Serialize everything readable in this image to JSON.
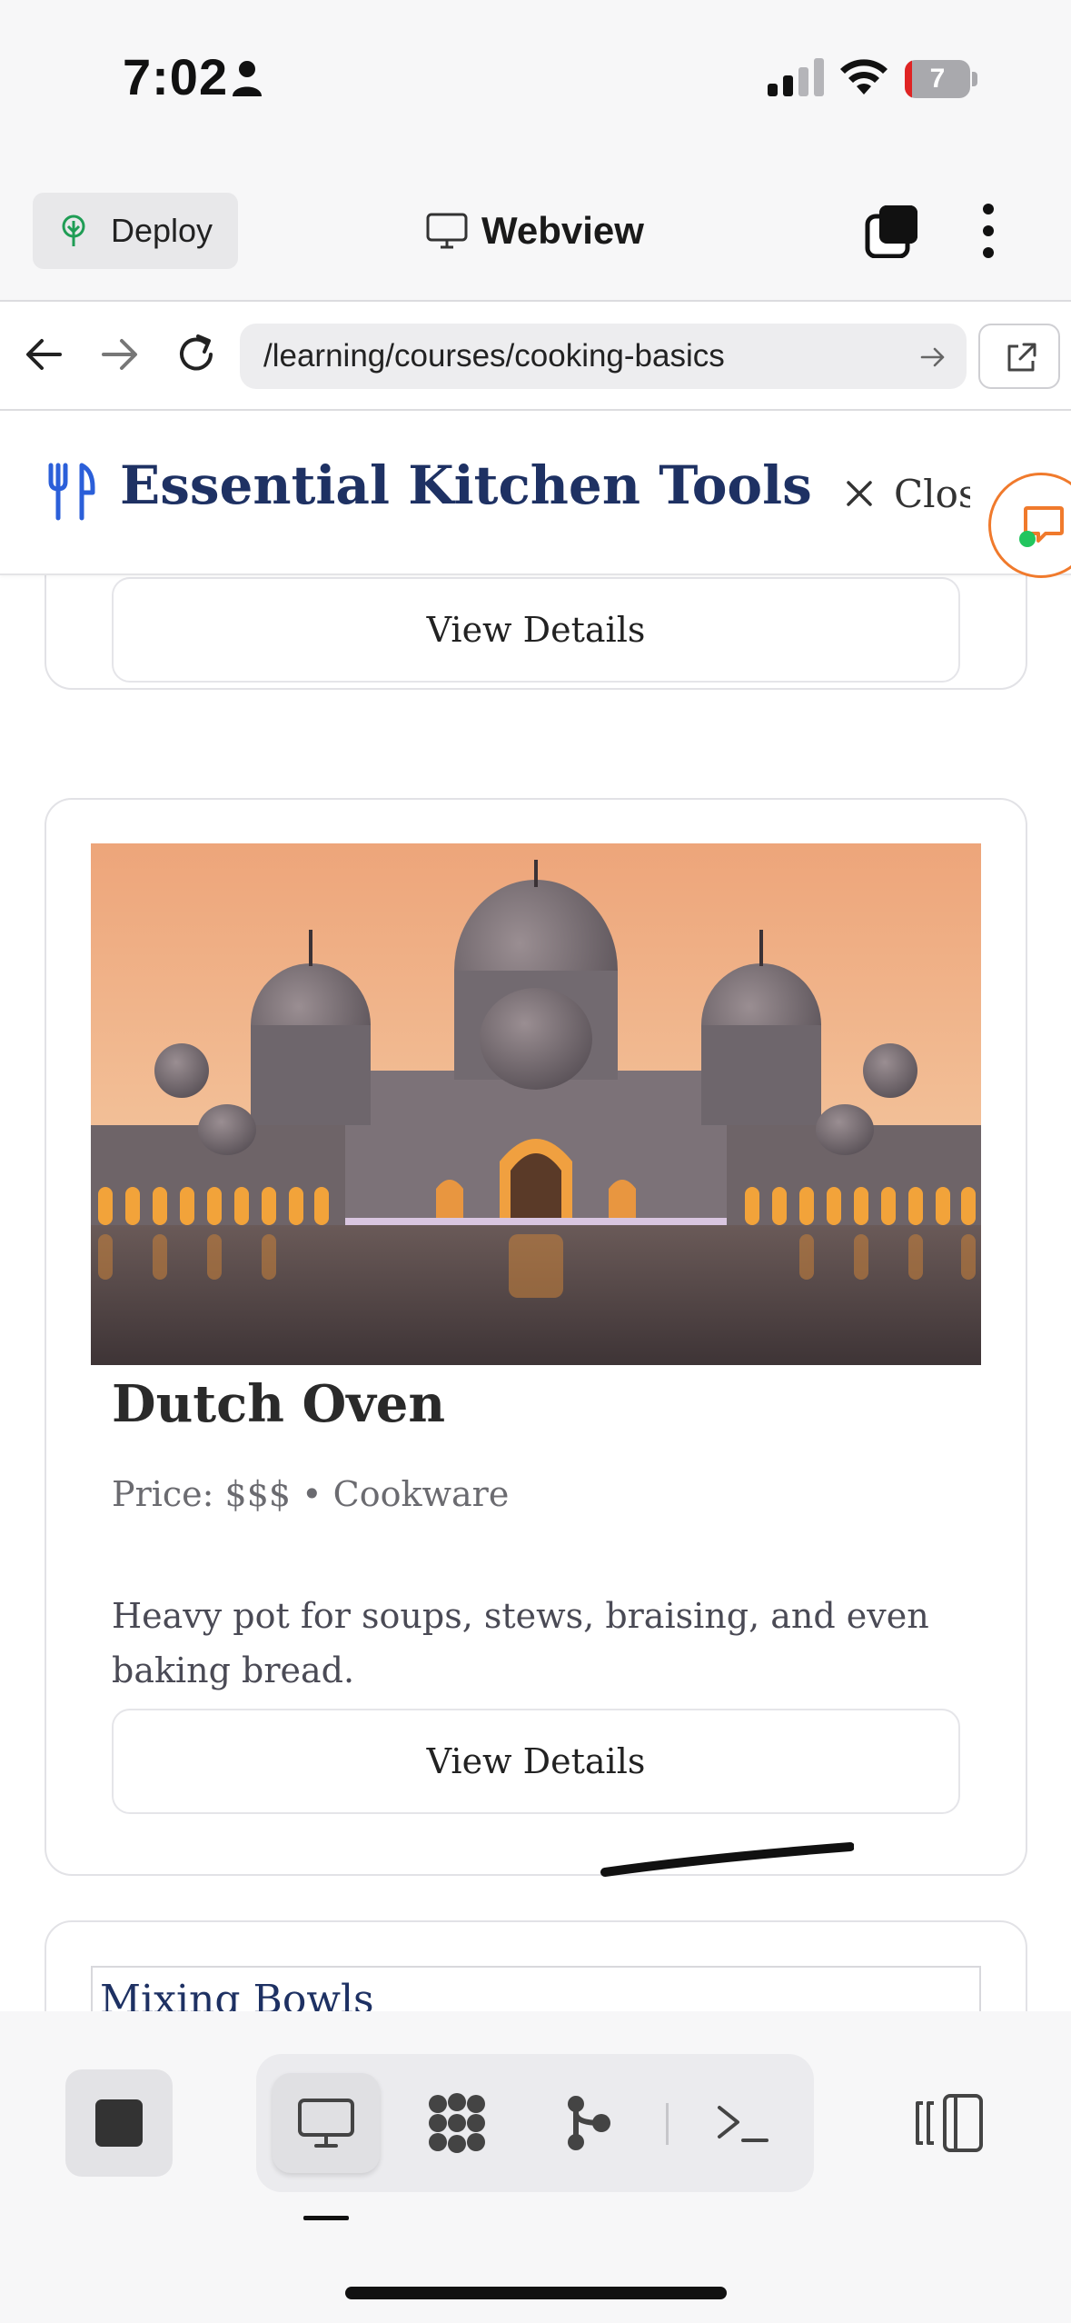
{
  "status_bar": {
    "time": "7:02",
    "battery": "7"
  },
  "app_header": {
    "deploy_label": "Deploy",
    "view_title": "Webview"
  },
  "url_bar": {
    "url": "/learning/courses/cooking-basics"
  },
  "page": {
    "title": "Essential Kitchen Tools",
    "close_label": "Close",
    "cards": [
      {
        "button_label": "View Details"
      },
      {
        "title": "Dutch Oven",
        "meta": "Price: $$$ • Cookware",
        "description": "Heavy pot for soups, stews, braising, and even baking bread.",
        "button_label": "View Details"
      },
      {
        "title": "Mixing Bowls"
      }
    ]
  },
  "colors": {
    "accent_orange": "#f07a2c",
    "title_navy": "#1e3163",
    "link_blue": "#2b5fd9"
  },
  "icons": [
    "person-icon",
    "cellular-signal-icon",
    "wifi-icon",
    "battery-icon",
    "tree-icon",
    "monitor-icon",
    "tabs-icon",
    "more-vertical-icon",
    "back-arrow-icon",
    "forward-arrow-icon",
    "reload-icon",
    "go-arrow-icon",
    "external-link-icon",
    "fork-knife-icon",
    "close-icon",
    "chat-bubble-icon",
    "stop-icon",
    "desktop-icon",
    "cluster-icon",
    "branch-icon",
    "terminal-icon",
    "side-panel-icon"
  ]
}
